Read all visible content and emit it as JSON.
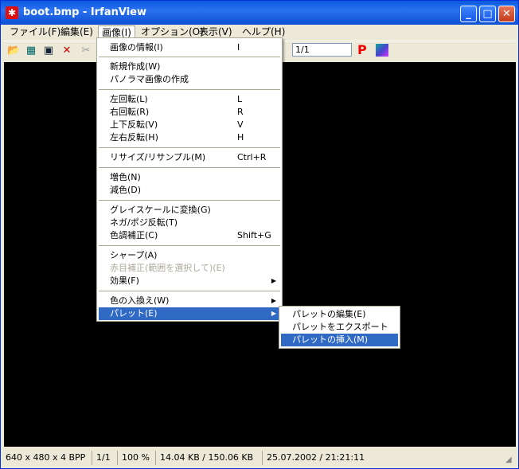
{
  "window": {
    "title": "boot.bmp - IrfanView"
  },
  "titlebar": {
    "minimize_glyph": "_",
    "maximize_glyph": "□",
    "close_glyph": "✕"
  },
  "menubar": [
    "ファイル(F)",
    "編集(E)",
    "画像(I)",
    "オプション(O)",
    "表示(V)",
    "ヘルプ(H)"
  ],
  "toolbar": {
    "page_value": "1/1",
    "p_label": "P",
    "icons": [
      "open-folder-icon",
      "slideshow-icon",
      "save-icon",
      "delete-icon",
      "cut-icon",
      "image-icon"
    ]
  },
  "image_menu": {
    "items": [
      {
        "label": "画像の情報(I)",
        "shortcut": "I"
      },
      {
        "label": "新規作成(W)",
        "shortcut": ""
      },
      {
        "label": "パノラマ画像の作成",
        "shortcut": ""
      },
      {
        "label": "左回転(L)",
        "shortcut": "L"
      },
      {
        "label": "右回転(R)",
        "shortcut": "R"
      },
      {
        "label": "上下反転(V)",
        "shortcut": "V"
      },
      {
        "label": "左右反転(H)",
        "shortcut": "H"
      },
      {
        "label": "リサイズ/リサンプル(M)",
        "shortcut": "Ctrl+R"
      },
      {
        "label": "増色(N)",
        "shortcut": ""
      },
      {
        "label": "減色(D)",
        "shortcut": ""
      },
      {
        "label": "グレイスケールに変換(G)",
        "shortcut": ""
      },
      {
        "label": "ネガ/ポジ反転(T)",
        "shortcut": ""
      },
      {
        "label": "色調補正(C)",
        "shortcut": "Shift+G"
      },
      {
        "label": "シャープ(A)",
        "shortcut": ""
      },
      {
        "label": "赤目補正(範囲を選択して)(E)",
        "shortcut": ""
      },
      {
        "label": "効果(F)",
        "shortcut": ""
      },
      {
        "label": "色の入換え(W)",
        "shortcut": ""
      },
      {
        "label": "パレット(E)",
        "shortcut": ""
      }
    ]
  },
  "palette_submenu": {
    "items": [
      {
        "label": "パレットの編集(E)"
      },
      {
        "label": "パレットをエクスポート(X)"
      },
      {
        "label": "パレットの挿入(M)"
      }
    ]
  },
  "statusbar": [
    "640 x 480 x 4 BPP",
    "1/1",
    "100 %",
    "14.04 KB / 150.06 KB",
    "25.07.2002 / 21:21:11"
  ],
  "colors": {
    "titlebar": "#0a5ae0",
    "highlight": "#316ac5",
    "canvas": "#000000",
    "chrome": "#ece9d8"
  }
}
